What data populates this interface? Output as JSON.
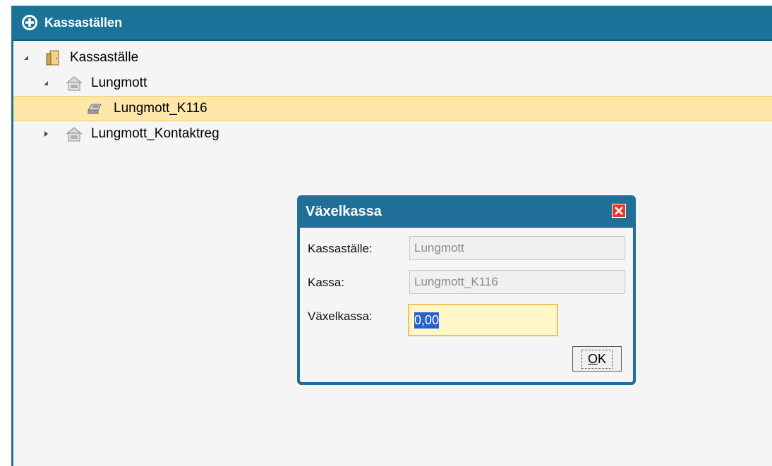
{
  "panel": {
    "title": "Kassaställen",
    "header_icon": "plus-circle-icon"
  },
  "tree": {
    "items": [
      {
        "label": "Kassaställe",
        "icon": "door-icon",
        "expander": "expanded"
      },
      {
        "label": "Lungmott",
        "icon": "house-icon",
        "expander": "expanded"
      },
      {
        "label": "Lungmott_K116",
        "icon": "cash-register-icon",
        "selected": true
      },
      {
        "label": "Lungmott_Kontaktreg",
        "icon": "house-icon",
        "expander": "collapsed"
      }
    ]
  },
  "dialog": {
    "title": "Växelkassa",
    "fields": [
      {
        "label": "Kassaställe:",
        "value": "Lungmott"
      },
      {
        "label": "Kassa:",
        "value": "Lungmott_K116"
      },
      {
        "label": "Växelkassa:",
        "value": "0,00"
      }
    ],
    "ok_mnemonic": "O",
    "ok_rest": "K"
  },
  "colors": {
    "header": "#1b7399",
    "selection": "#fde8a9",
    "input_bg": "#fff7c8",
    "close": "#e03a2e"
  }
}
